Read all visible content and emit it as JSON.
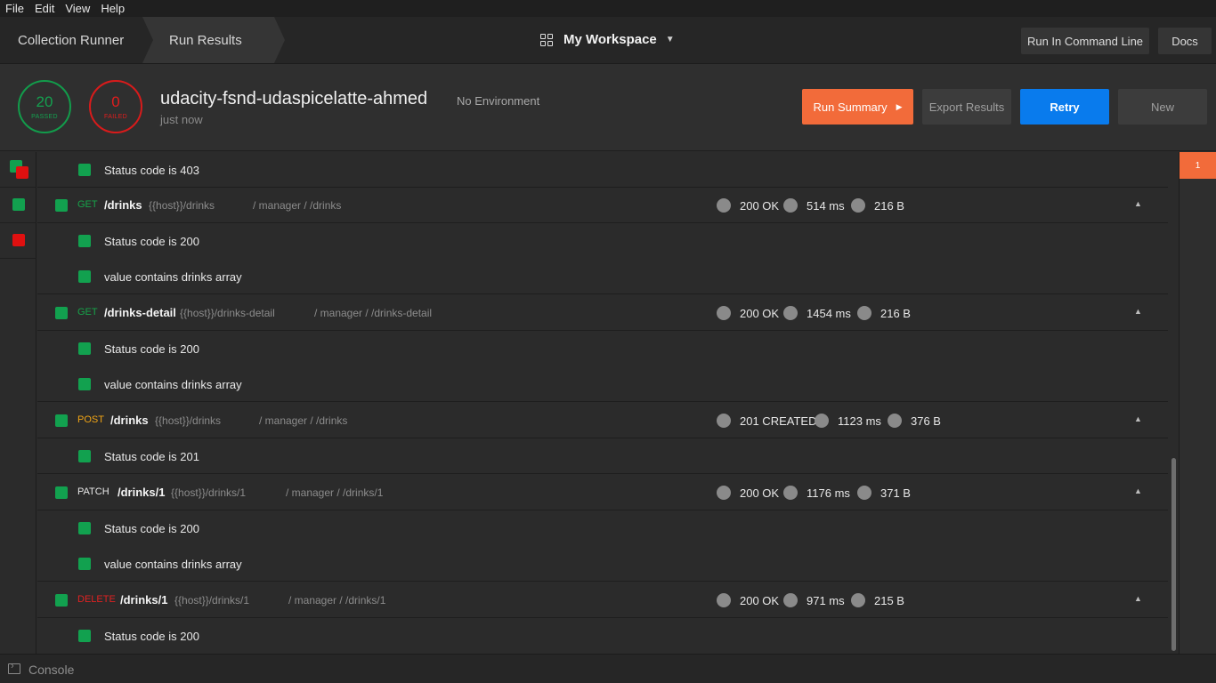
{
  "menu": [
    "File",
    "Edit",
    "View",
    "Help"
  ],
  "nav": {
    "crumb1": "Collection Runner",
    "crumb2": "Run Results",
    "workspace": "My Workspace",
    "run_cmd": "Run In Command Line",
    "docs": "Docs"
  },
  "summary": {
    "passed_count": "20",
    "passed_label": "PASSED",
    "failed_count": "0",
    "failed_label": "FAILED",
    "title": "udacity-fsnd-udaspicelatte-ahmed",
    "environment": "No Environment",
    "time": "just now",
    "btn_summary": "Run Summary",
    "btn_export": "Export Results",
    "btn_retry": "Retry",
    "btn_new": "New"
  },
  "rows": {
    "t0": "Status code is 403",
    "r1": {
      "method": "GET",
      "path": "/drinks",
      "url": "{{host}}/drinks",
      "folder": "/ manager / /drinks",
      "status": "200 OK",
      "time": "514 ms",
      "size": "216 B"
    },
    "t1a": "Status code is 200",
    "t1b": "value contains drinks array",
    "r2": {
      "method": "GET",
      "path": "/drinks-detail",
      "url": "{{host}}/drinks-detail",
      "folder": "/ manager / /drinks-detail",
      "status": "200 OK",
      "time": "1454 ms",
      "size": "216 B"
    },
    "t2a": "Status code is 200",
    "t2b": "value contains drinks array",
    "r3": {
      "method": "POST",
      "path": "/drinks",
      "url": "{{host}}/drinks",
      "folder": "/ manager / /drinks",
      "status": "201 CREATED",
      "time": "1123 ms",
      "size": "376 B"
    },
    "t3a": "Status code is 201",
    "r4": {
      "method": "PATCH",
      "path": "/drinks/1",
      "url": "{{host}}/drinks/1",
      "folder": "/ manager / /drinks/1",
      "status": "200 OK",
      "time": "1176 ms",
      "size": "371 B"
    },
    "t4a": "Status code is 200",
    "t4b": "value contains drinks array",
    "r5": {
      "method": "DELETE",
      "path": "/drinks/1",
      "url": "{{host}}/drinks/1",
      "folder": "/ manager / /drinks/1",
      "status": "200 OK",
      "time": "971 ms",
      "size": "215 B"
    },
    "t5a": "Status code is 200"
  },
  "iteration": "1",
  "console": "Console",
  "colors": {
    "pass": "#12a14f",
    "fail": "#e01010",
    "accent": "#f26b3a",
    "retry": "#097bed"
  }
}
